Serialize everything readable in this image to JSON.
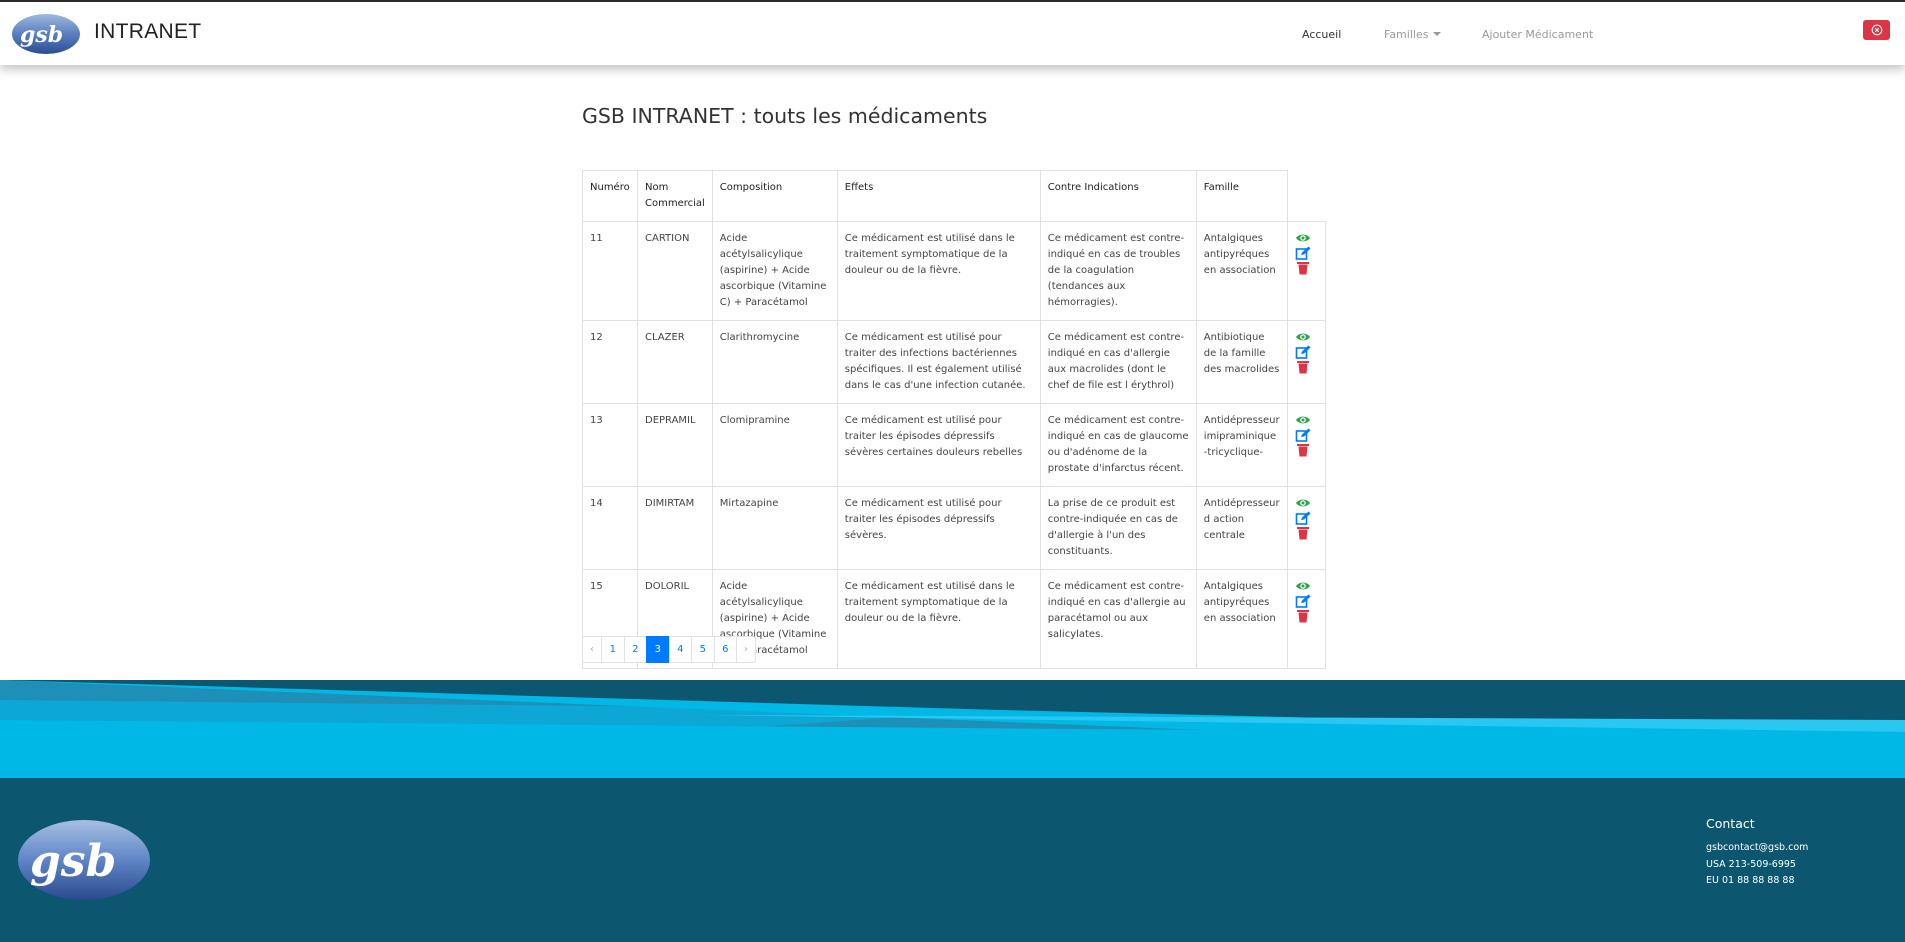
{
  "header": {
    "logo_text": "gsb",
    "brand": "INTRANET",
    "nav": {
      "home": "Accueil",
      "families": "Familles",
      "add": "Ajouter Médicament"
    }
  },
  "main": {
    "title": "GSB INTRANET : touts les médicaments",
    "columns": [
      "Numéro",
      "Nom Commercial",
      "Composition",
      "Effets",
      "Contre Indications",
      "Famille"
    ],
    "rows": [
      {
        "numero": "11",
        "nom": "CARTION",
        "composition": "Acide acétylsalicylique (aspirine) + Acide ascorbique (Vitamine C) + Paracétamol",
        "effets": "Ce médicament est utilisé dans le traitement symptomatique de la douleur ou de la fièvre.",
        "contre": "Ce médicament est contre-indiqué en cas de troubles de la coagulation (tendances aux hémorragies).",
        "famille": "Antalgiques antipyréques en association"
      },
      {
        "numero": "12",
        "nom": "CLAZER",
        "composition": "Clarithromycine",
        "effets": "Ce médicament est utilisé pour traiter des infections bactériennes spécifiques. Il est également utilisé dans le cas d'une infection cutanée.",
        "contre": "Ce médicament est contre-indiqué en cas d'allergie aux macrolides (dont le chef de file est l érythrol)",
        "famille": "Antibiotique de la famille des macrolides"
      },
      {
        "numero": "13",
        "nom": "DEPRAMIL",
        "composition": "Clomipramine",
        "effets": "Ce médicament est utilisé pour traiter les épisodes dépressifs sévères certaines douleurs rebelles",
        "contre": "Ce médicament est contre-indiqué en cas de glaucome ou d'adénome de la prostate d'infarctus récent.",
        "famille": "Antidépresseur imipraminique -tricyclique-"
      },
      {
        "numero": "14",
        "nom": "DIMIRTAM",
        "composition": "Mirtazapine",
        "effets": "Ce médicament est utilisé pour traiter les épisodes dépressifs sévères.",
        "contre": "La prise de ce produit est contre-indiquée en cas de d'allergie à l'un des constituants.",
        "famille": "Antidépresseur d action centrale"
      },
      {
        "numero": "15",
        "nom": "DOLORIL",
        "composition": "Acide acétylsalicylique (aspirine) + Acide ascorbique (Vitamine C) + Paracétamol",
        "effets": "Ce médicament est utilisé dans le traitement symptomatique de la douleur ou de la fièvre.",
        "contre": "Ce médicament est contre-indiqué en cas d'allergie au paracétamol ou aux salicylates.",
        "famille": "Antalgiques antipyréques en association"
      }
    ],
    "row_actions": [
      "view-icon",
      "edit-icon",
      "delete-icon"
    ]
  },
  "pagination": {
    "prev": "‹",
    "pages": [
      "1",
      "2",
      "3",
      "4",
      "5",
      "6"
    ],
    "current": "3",
    "next": "›"
  },
  "footer": {
    "logo_text": "gsb",
    "contact_title": "Contact",
    "email": "gsbcontact@gsb.com",
    "usa": "USA 213-509-6995",
    "eu": "EU 01 88 88 88 88"
  },
  "colors": {
    "primary": "#007bff",
    "danger": "#dc3545",
    "success": "#28a745",
    "footer": "#0d5670",
    "wave_light": "#00b8e6",
    "wave_mid": "#1e90b8"
  }
}
